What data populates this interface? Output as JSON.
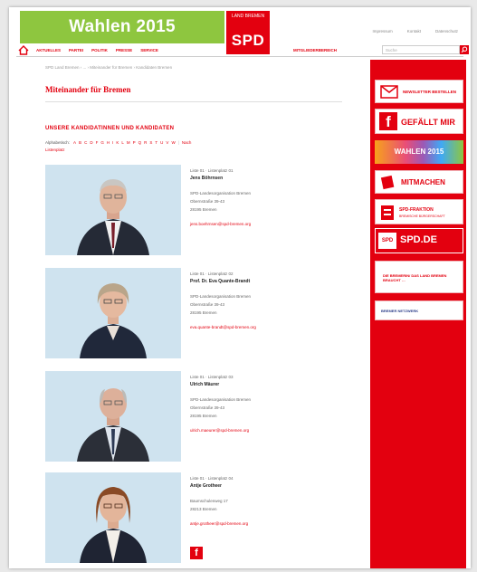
{
  "header": {
    "banner": "Wahlen 2015",
    "logo_small": "LAND BREMEN",
    "logo_big": "SPD",
    "toplinks": [
      "Impressum",
      "Kontakt",
      "Datenschutz"
    ]
  },
  "nav": {
    "items": [
      "AKTUELLES",
      "PARTEI",
      "POLITIK",
      "PRESSE",
      "SERVICE"
    ],
    "member_link": "MITGLIEDERBEREICH",
    "search_placeholder": "Suche"
  },
  "breadcrumb": "SPD Land Bremen › ... › Miteinander für Bremen › Kandidaten Bremen",
  "page_title": "Miteinander für Bremen",
  "section_heading": "UNSERE KANDIDATINNEN UND KANDIDATEN",
  "alphabet": {
    "label": "Alphabetisch:",
    "letters": [
      "A",
      "B",
      "C",
      "D",
      "F",
      "G",
      "H",
      "I",
      "K",
      "L",
      "M",
      "P",
      "Q",
      "R",
      "S",
      "T",
      "U",
      "V",
      "W"
    ],
    "nach": "Nach",
    "listenplatz": "Listenplatz"
  },
  "candidates": [
    {
      "meta": "Liste 01 · Listenplatz 01",
      "name": "Jens Böhrnsen",
      "org": "SPD-Landesorganisation Bremen",
      "street": "Obernstraße 39-43",
      "city": "28195 Bremen",
      "email": "jens.boehrnsen@spd-bremen.org"
    },
    {
      "meta": "Liste 01 · Listenplatz 02",
      "name": "Prof. Dr. Eva Quante-Brandt",
      "org": "SPD-Landesorganisation Bremen",
      "street": "Obernstraße 39-43",
      "city": "28195 Bremen",
      "email": "eva.quante-brandt@spd-bremen.org"
    },
    {
      "meta": "Liste 01 · Listenplatz 03",
      "name": "Ulrich Mäurer",
      "org": "SPD-Landesorganisation Bremen",
      "street": "Obernstraße 39-43",
      "city": "28195 Bremen",
      "email": "ulrich.maeurer@spd-bremen.org"
    },
    {
      "meta": "Liste 01 · Listenplatz 04",
      "name": "Antje Grotheer",
      "street": "Baumschulenweg 17",
      "city": "28213 Bremen",
      "email": "antje.grotheer@spd-bremen.org"
    }
  ],
  "sidebar": {
    "newsletter": "NEWSLETTER BESTELLEN",
    "facebook": "GEFÄLLT MIR",
    "wahlen": "WAHLEN 2015",
    "mitmachen": "MITMACHEN",
    "fraktion": "SPD-FRAKTION",
    "fraktion_sub": "BREMISCHE BÜRGERSCHAFT",
    "spdde": "SPD.DE",
    "spdde_mini": "SPD",
    "promo1": "DIE BREMERIN/ DAS LAND BREMEN BRAUCHT …",
    "promo2": "BREMER NETZWERK"
  },
  "colors": {
    "spd_red": "#e3000f",
    "banner_green": "#8ec63f"
  }
}
